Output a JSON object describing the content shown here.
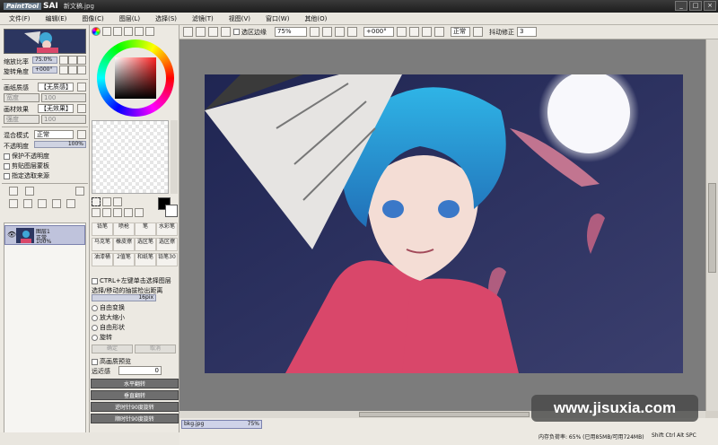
{
  "titlebar": {
    "logo": "PaintTool",
    "app": "SAI",
    "file": "新文稿.jpg",
    "controls": [
      "_",
      "□",
      "×"
    ]
  },
  "menu": [
    "文件(F)",
    "编辑(E)",
    "图像(C)",
    "图层(L)",
    "选择(S)",
    "滤镜(T)",
    "视图(V)",
    "窗口(W)",
    "其他(O)"
  ],
  "navigator": {
    "zoom_label": "缩放比率",
    "zoom_value": "75.0%",
    "angle_label": "旋转角度",
    "angle_value": "+000°"
  },
  "layer_props": {
    "texture_label": "画纸质感",
    "texture_value": "【无质感】",
    "effect_label": "画材效果",
    "effect_value": "【无效果】",
    "width_label": "宽度",
    "width_value": "100",
    "strength_label": "强度",
    "strength_value": "100",
    "blend_label": "混合模式",
    "blend_value": "正常",
    "opacity_label": "不透明度",
    "opacity_value": "100%",
    "opt1": "保护不透明度",
    "opt2": "剪贴图层蒙板",
    "opt3": "指定选取来源"
  },
  "layers": [
    {
      "name": "图层1",
      "mode": "正常",
      "opacity": "100%"
    }
  ],
  "tools": {
    "row1": [
      "铅笔",
      "喷枪",
      "笔",
      "水彩笔"
    ],
    "row2": [
      "马克笔",
      "橡皮擦",
      "选区笔",
      "选区擦"
    ],
    "row3": [
      "油漆桶",
      "2值笔",
      "和纸笔",
      "铅笔30"
    ],
    "mode": "选择/移动的抽拔检出距离",
    "mode_value": "16pix",
    "ctrl_opt": "CTRL+左键单击选择图层"
  },
  "transform": {
    "options": [
      "自由变换",
      "放大缩小",
      "自由形状",
      "旋转"
    ],
    "ok": "确定",
    "cancel": "取消",
    "hq_preview": "高画质预览",
    "perspective_label": "远近感",
    "perspective_value": "0",
    "buttons": [
      "水平翻转",
      "垂直翻转",
      "逆时针90度旋转",
      "顺时针90度旋转"
    ]
  },
  "toolbar": {
    "sel_edge": "选区边缘",
    "zoom": "75%",
    "angle": "+000°",
    "mode": "正常",
    "stab_label": "抖动修正",
    "stab_value": "3"
  },
  "status": {
    "tab_name": "bkg.jpg",
    "tab_zoom": "75%",
    "memory": "内存负荷率: 65% (已用85MB/可用724MB)",
    "keys": "Shift Ctrl Alt SPC",
    "watermark": "www.jisuxia.com"
  },
  "colors": {
    "accent": "#1c4eb2",
    "canvas_bg": "#7c7c7c"
  }
}
